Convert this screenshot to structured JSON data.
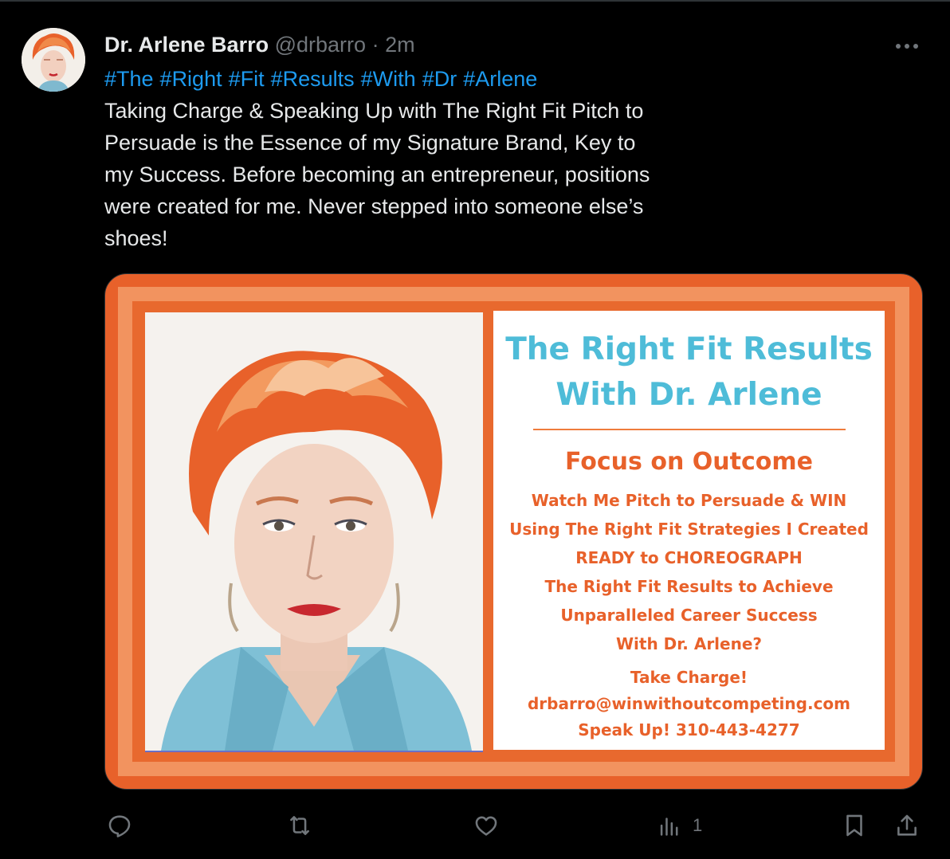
{
  "tweet": {
    "display_name": "Dr. Arlene Barro",
    "handle": "@drbarro",
    "separator": "·",
    "time": "2m",
    "hashtags": [
      "#The",
      "#Right",
      "#Fit",
      "#Results",
      "#With",
      "#Dr",
      "#Arlene"
    ],
    "text": "Taking Charge & Speaking Up with The Right Fit Pitch to Persuade is the Essence of my Signature Brand, Key to my Success. Before becoming an entrepreneur, positions were created for me. Never stepped into someone else’s shoes!"
  },
  "media_card": {
    "title_line1": "The Right Fit Results",
    "title_line2": "With Dr. Arlene",
    "subtitle": "Focus on Outcome",
    "lines": [
      "Watch Me Pitch to Persuade & WIN",
      "Using The Right Fit Strategies I Created",
      "READY to CHOREOGRAPH",
      "The Right Fit Results to Achieve",
      "Unparalleled Career Success",
      "With Dr. Arlene?"
    ],
    "cta_lines": [
      "Take Charge!",
      "drbarro@winwithoutcompeting.com",
      "Speak Up! 310-443-4277"
    ]
  },
  "actions": {
    "reply_icon": "reply-icon",
    "retweet_icon": "retweet-icon",
    "like_icon": "heart-icon",
    "views_icon": "views-icon",
    "views_count": "1",
    "bookmark_icon": "bookmark-icon",
    "share_icon": "share-icon"
  },
  "colors": {
    "background": "#000000",
    "hashtag": "#1d9bf0",
    "secondary_text": "#71767b",
    "card_orange": "#e8612a",
    "card_title_teal": "#4ebcd8"
  }
}
